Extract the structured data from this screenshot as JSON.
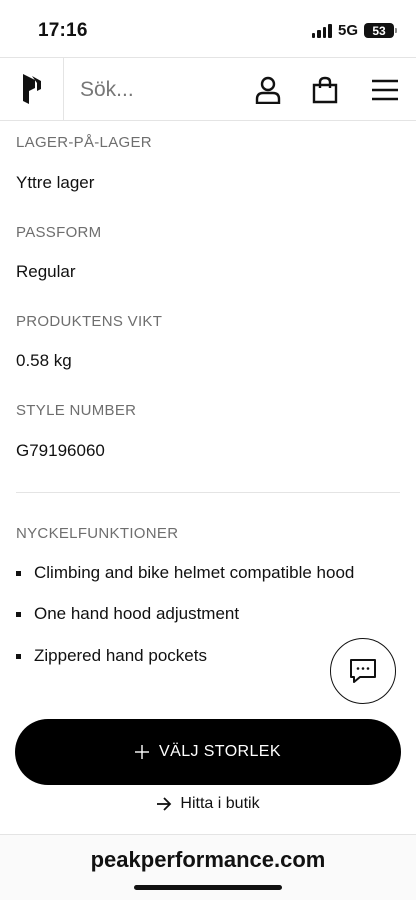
{
  "status_bar": {
    "time": "17:16",
    "network": "5G",
    "battery": "53"
  },
  "header": {
    "search_placeholder": "Sök..."
  },
  "specs": [
    {
      "label": "LAGER-PÅ-LAGER",
      "value": "Yttre lager"
    },
    {
      "label": "PASSFORM",
      "value": "Regular"
    },
    {
      "label": "PRODUKTENS VIKT",
      "value": "0.58 kg"
    },
    {
      "label": "STYLE NUMBER",
      "value": "G79196060"
    }
  ],
  "key_features": {
    "title": "NYCKELFUNKTIONER",
    "items": [
      "Climbing and bike helmet compatible hood",
      "One hand hood adjustment",
      "Zippered hand pockets"
    ]
  },
  "cta": {
    "icon": "plus",
    "label": "VÄLJ STORLEK"
  },
  "find_store": {
    "icon": "arrow-right",
    "label": "Hitta i butik"
  },
  "browser": {
    "url": "peakperformance.com"
  }
}
